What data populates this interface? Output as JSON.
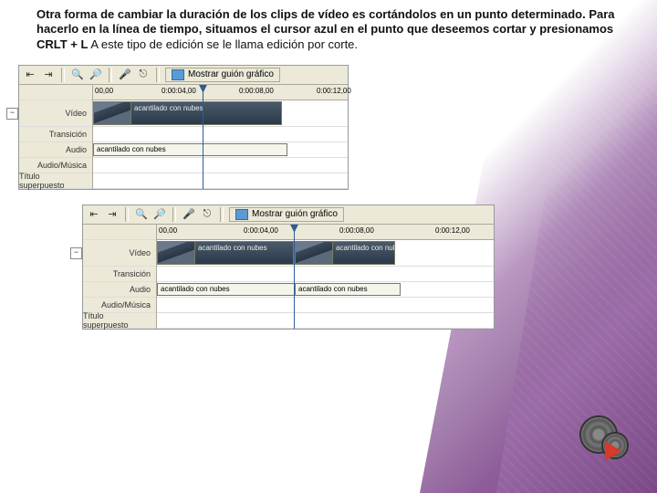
{
  "paragraph": {
    "part1": "Otra forma de cambiar la duración de los clips de vídeo es cortándolos en un punto determinado. Para hacerlo en la línea de tiempo, situamos el cursor azul en el punto que deseemos cortar y presionamos CRLT + L",
    "part2": " A este tipo de edición se le llama edición por corte."
  },
  "toolbar": {
    "storyboard_label": "Mostrar guión gráfico"
  },
  "ruler1": {
    "t0": "00,00",
    "t1": "0:00:04,00",
    "t2": "0:00:08,00",
    "t3": "0:00:12,00"
  },
  "ruler2": {
    "t0": "00,00",
    "t1": "0:00:04,00",
    "t2": "0:00:08,00",
    "t3": "0:00:12,00"
  },
  "tracks": {
    "video": "Vídeo",
    "transition": "Transición",
    "audio": "Audio",
    "audio_music": "Audio/Música",
    "title_overlay": "Título superpuesto"
  },
  "clips": {
    "name": "acantilado con nubes"
  }
}
